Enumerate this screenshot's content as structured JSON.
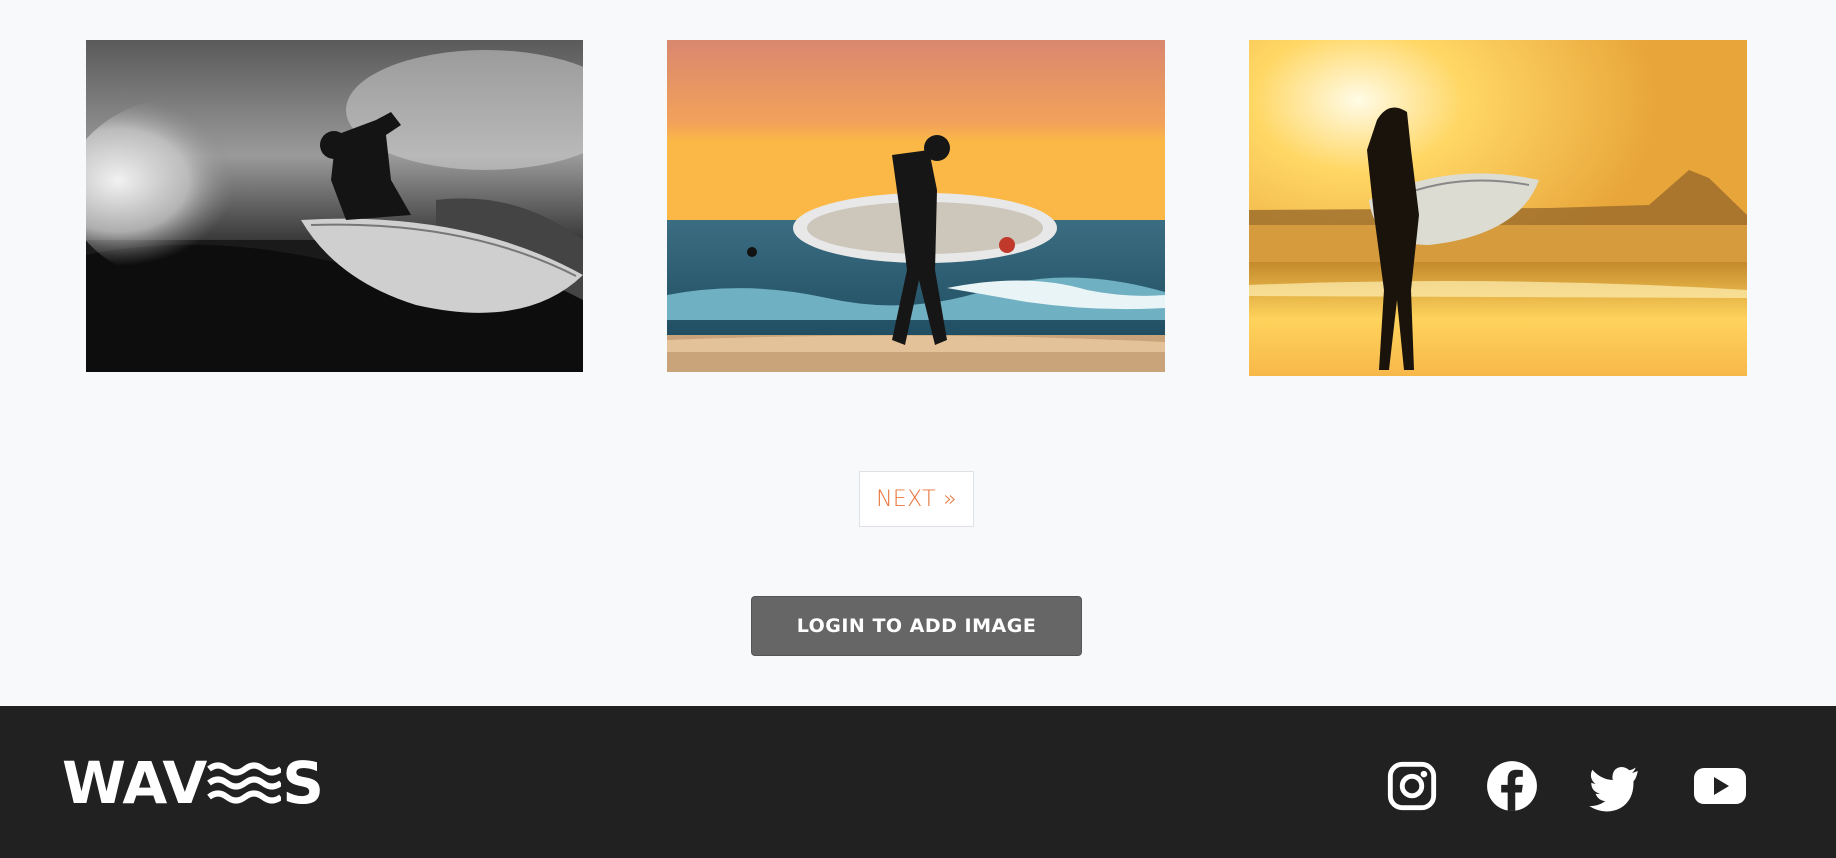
{
  "gallery": {
    "images": [
      {
        "alt": "surfer carving wave in black and white"
      },
      {
        "alt": "surfer walking with board at sunset"
      },
      {
        "alt": "woman holding surfboard on golden beach"
      }
    ]
  },
  "pagination": {
    "next_label": "NEXT »"
  },
  "actions": {
    "login_label": "LOGIN TO ADD IMAGE"
  },
  "footer": {
    "logo": {
      "left": "WAV",
      "right": "S"
    },
    "social": [
      {
        "icon": "instagram-icon"
      },
      {
        "icon": "facebook-icon"
      },
      {
        "icon": "twitter-icon"
      },
      {
        "icon": "youtube-icon"
      }
    ]
  },
  "colors": {
    "background": "#f8f9fa",
    "accent": "#e8743b",
    "button": "#666666",
    "footer": "#212121"
  }
}
